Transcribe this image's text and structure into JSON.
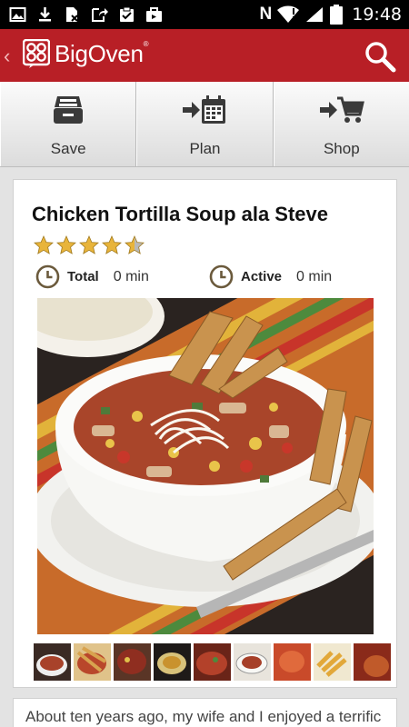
{
  "status_bar": {
    "time": "19:48",
    "left_icons": [
      "image-icon",
      "download-icon",
      "no-sim-icon",
      "share-icon",
      "clipboard-check-icon",
      "briefcase-icon"
    ],
    "right_icons": [
      "nfc-icon",
      "wifi-icon",
      "signal-icon",
      "battery-icon"
    ],
    "nfc_label": "N"
  },
  "app_bar": {
    "brand": "BigOven",
    "trademark": "®",
    "back_icon": "chevron-left-icon",
    "search_icon": "search-icon",
    "color": "#b81f26"
  },
  "toolbar": {
    "save_label": "Save",
    "plan_label": "Plan",
    "shop_label": "Shop"
  },
  "recipe": {
    "title": "Chicken Tortilla Soup ala Steve",
    "rating": 4.5,
    "rating_max": 5,
    "total_label": "Total",
    "total_value": "0 min",
    "active_label": "Active",
    "active_value": "0 min",
    "photo_count_shown": 9,
    "description": "About ten years ago, my wife and I enjoyed a terrific"
  },
  "colors": {
    "star_fill": "#e8b43a",
    "star_empty": "#b8b8b8",
    "clock": "#6b5a3c"
  }
}
